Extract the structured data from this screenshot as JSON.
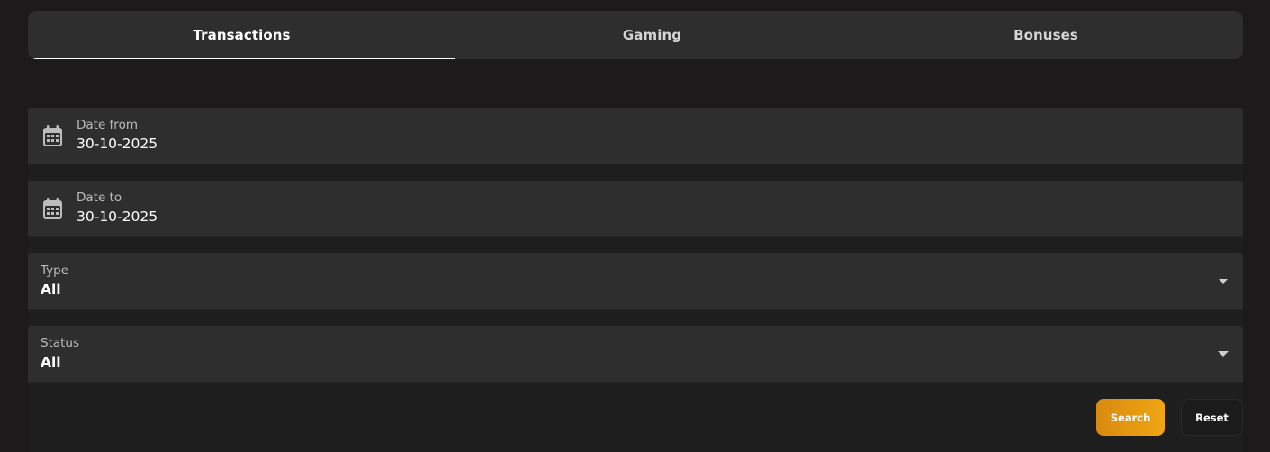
{
  "tabs": [
    {
      "label": "Transactions",
      "active": true
    },
    {
      "label": "Gaming",
      "active": false
    },
    {
      "label": "Bonuses",
      "active": false
    }
  ],
  "filters": {
    "date_from": {
      "label": "Date from",
      "value": "30-10-2025",
      "icon": "calendar-icon"
    },
    "date_to": {
      "label": "Date to",
      "value": "30-10-2025",
      "icon": "calendar-icon"
    },
    "type": {
      "label": "Type",
      "value": "All",
      "icon": "caret-down-icon"
    },
    "status": {
      "label": "Status",
      "value": "All",
      "icon": "caret-down-icon"
    }
  },
  "actions": {
    "search_label": "Search",
    "reset_label": "Reset"
  },
  "colors": {
    "background": "#1c1a1b",
    "surface": "#2f2e2f",
    "accent_start": "#d88a10",
    "accent_end": "#f0a612",
    "text": "#ffffff",
    "muted_text": "#bdbcbd"
  }
}
